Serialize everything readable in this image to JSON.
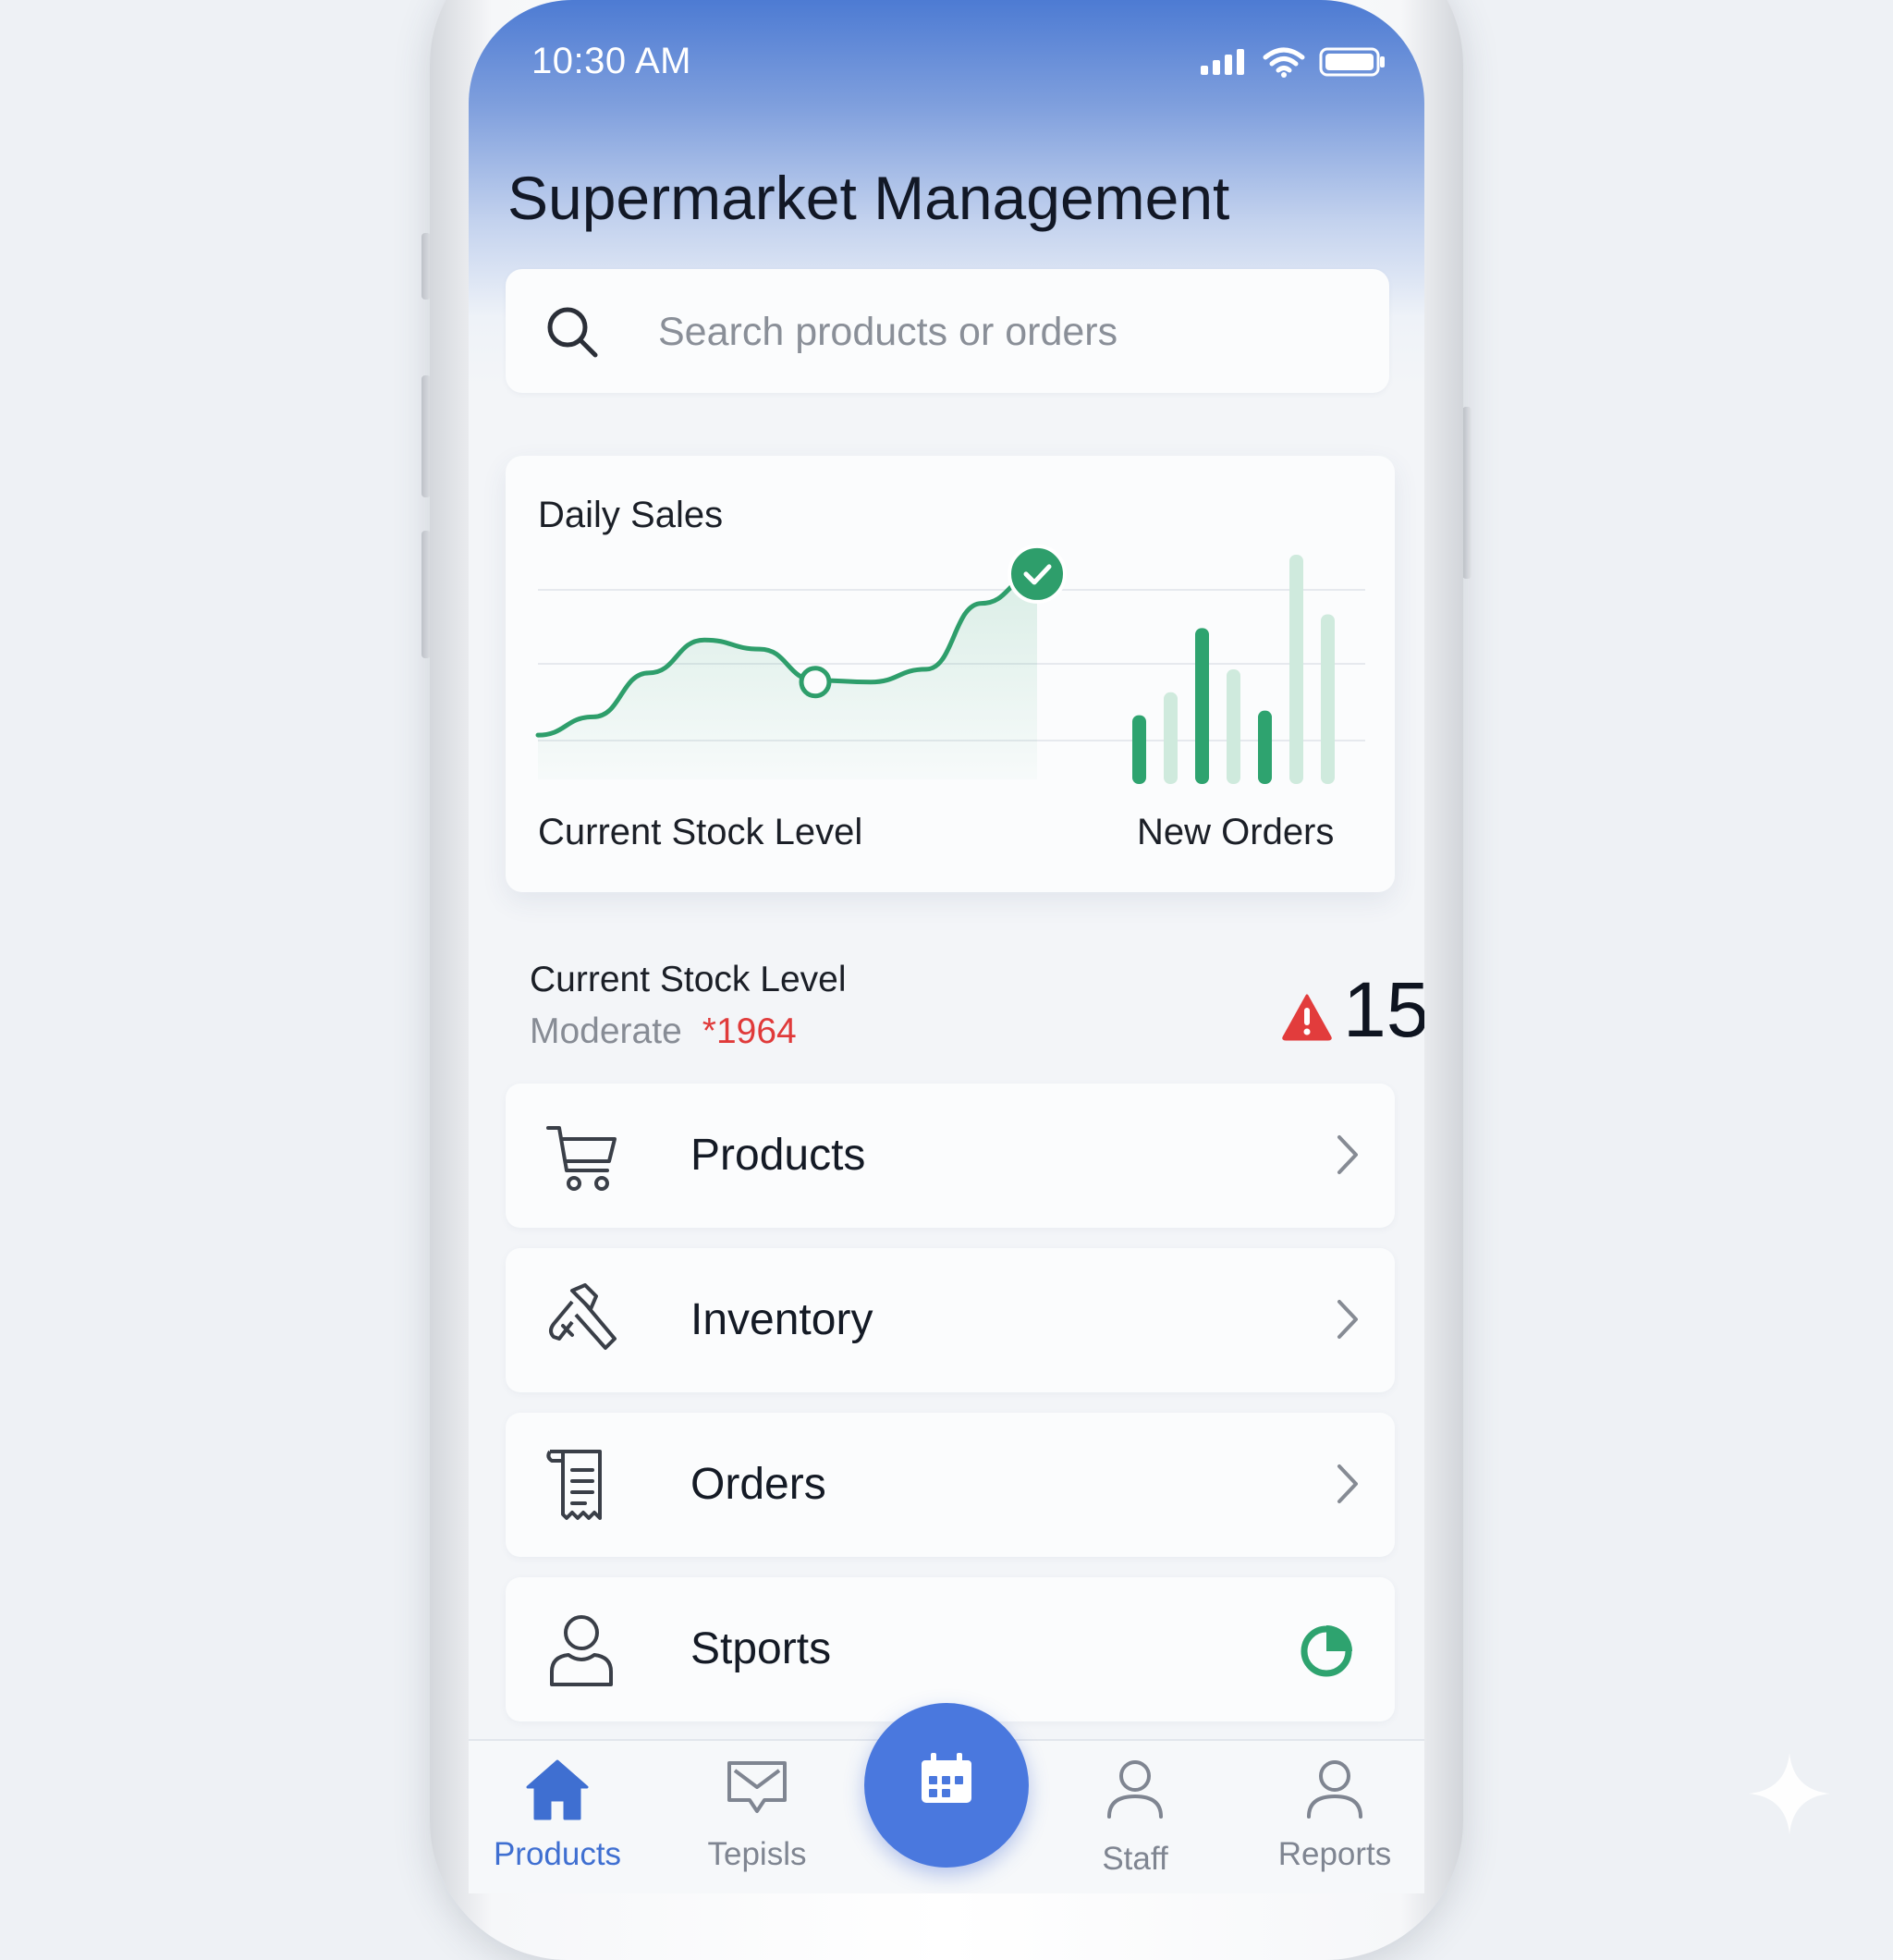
{
  "status_bar": {
    "time": "10:30 AM"
  },
  "header": {
    "title": "Supermarket Management"
  },
  "search": {
    "placeholder": "Search products or orders"
  },
  "sales_card": {
    "title": "Daily Sales",
    "left_label": "Current Stock Level",
    "right_label": "New Orders"
  },
  "chart_data": {
    "type": "line",
    "title": "Daily Sales",
    "note_line": "smooth rising line with highlighted final point (check mark)",
    "series": [
      {
        "values": [
          0.08,
          0.18,
          0.42,
          0.6,
          0.55,
          0.38,
          0.37,
          0.44,
          0.8,
          0.96
        ]
      }
    ],
    "bars": {
      "type": "bar",
      "label": "New Orders",
      "values": [
        0.3,
        0.4,
        0.68,
        0.5,
        0.32,
        1.0,
        0.74
      ],
      "emphasis": [
        true,
        false,
        true,
        false,
        true,
        false,
        false
      ]
    },
    "colors": {
      "line": "#2e9e6b",
      "bar_strong": "#2ea36f",
      "bar_light": "#cfeadd"
    }
  },
  "stock": {
    "title": "Current Stock Level",
    "status": "Moderate",
    "code": "*1964",
    "alert_count": "15"
  },
  "menu": [
    {
      "label": "Products",
      "icon": "cart-icon"
    },
    {
      "label": "Inventory",
      "icon": "tools-icon"
    },
    {
      "label": "Orders",
      "icon": "receipt-icon"
    },
    {
      "label": "Stports",
      "icon": "person-icon"
    }
  ],
  "tabs": [
    {
      "label": "Products",
      "icon": "home-icon",
      "active": true
    },
    {
      "label": "Tepisls",
      "icon": "message-icon",
      "active": false
    },
    {
      "label": "Staff",
      "icon": "staff-icon",
      "active": false
    },
    {
      "label": "Reports",
      "icon": "reports-icon",
      "active": false
    }
  ],
  "colors": {
    "accent": "#4a78de",
    "success": "#2ea36f",
    "danger": "#e03a3a"
  }
}
